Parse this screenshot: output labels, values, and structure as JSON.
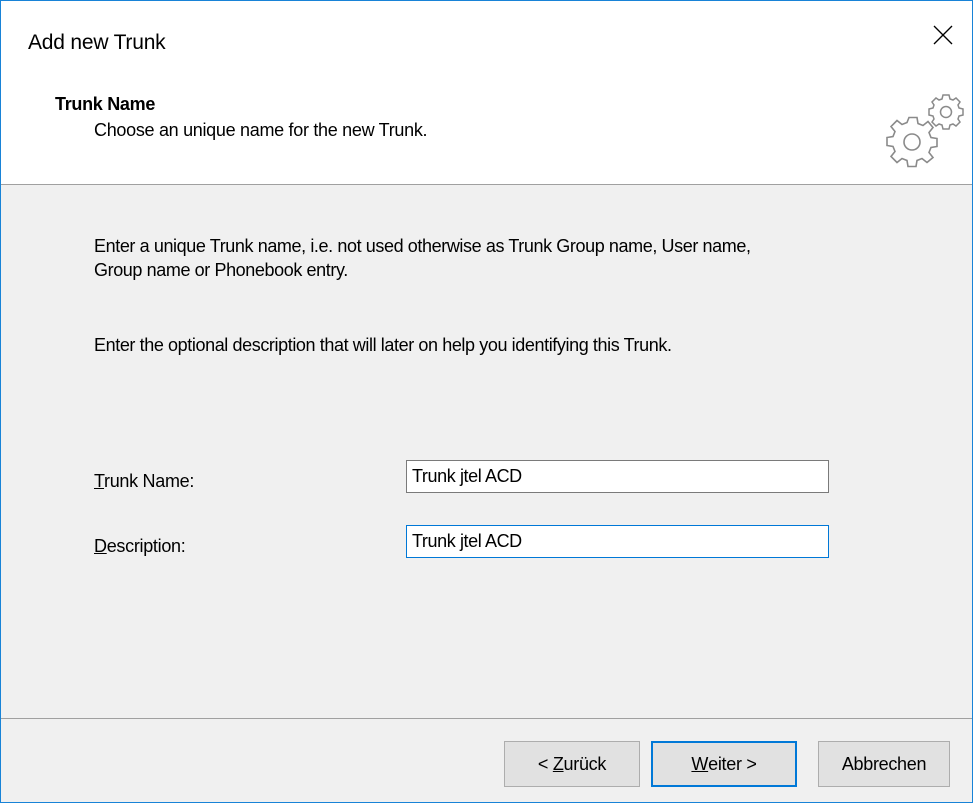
{
  "window": {
    "title": "Add new Trunk"
  },
  "header": {
    "title": "Trunk Name",
    "subtitle": "Choose an unique name for the new Trunk.",
    "icon": "gears-icon"
  },
  "body": {
    "paragraph1_line1": "Enter a unique Trunk name, i.e. not used otherwise as Trunk Group name, User name,",
    "paragraph1_line2": "Group name or Phonebook entry.",
    "paragraph2": "Enter the optional description that will later on help you identifying this Trunk."
  },
  "form": {
    "trunk_name": {
      "label_accel": "T",
      "label_rest": "runk Name:",
      "value": "Trunk jtel ACD"
    },
    "description": {
      "label_accel": "D",
      "label_rest": "escription:",
      "value": "Trunk jtel ACD"
    }
  },
  "buttons": {
    "back": {
      "prefix": "< ",
      "accel": "Z",
      "rest": "urück"
    },
    "next": {
      "accel": "W",
      "rest": "eiter >"
    },
    "cancel": {
      "label": "Abbrechen"
    }
  },
  "colors": {
    "accent": "#0078d7",
    "window_border": "#1883d7",
    "dialog_bg": "#f0f0f0",
    "header_bg": "#ffffff",
    "button_bg": "#e1e1e1"
  }
}
